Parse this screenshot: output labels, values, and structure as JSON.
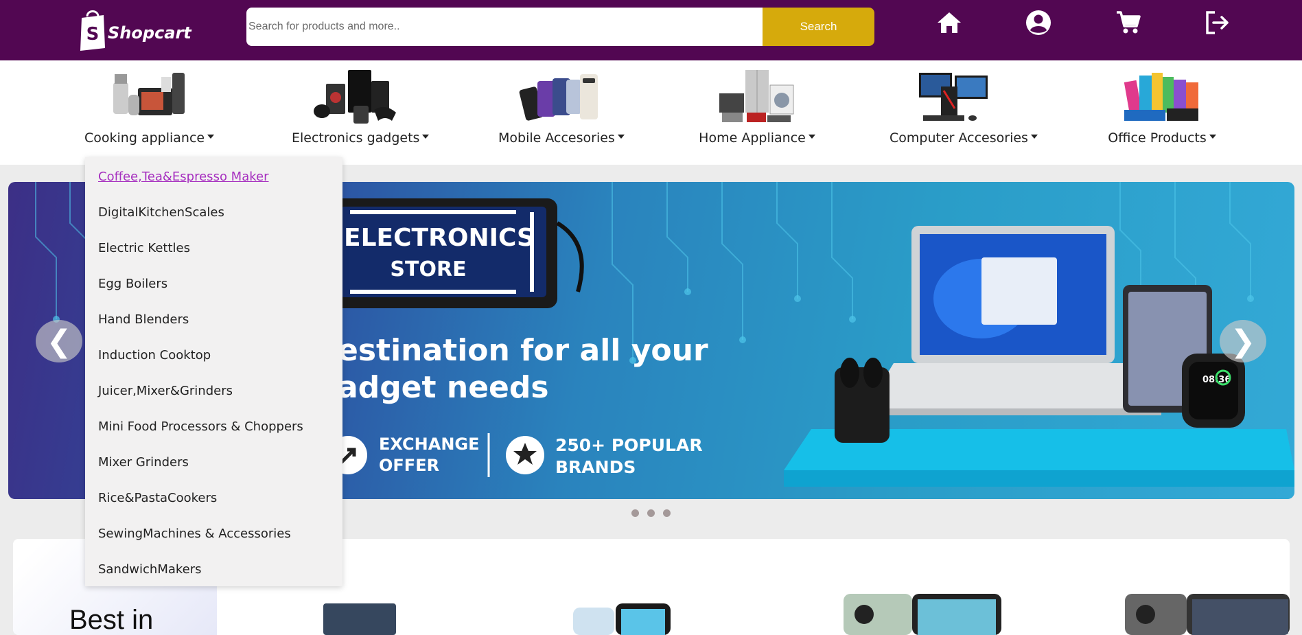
{
  "header": {
    "brand": "Shopcart",
    "logo_letter": "S",
    "search_placeholder": "Search for products and more..",
    "search_button": "Search",
    "icons": [
      "home-icon",
      "account-icon",
      "cart-icon",
      "logout-icon"
    ]
  },
  "categories": [
    {
      "label": "Cooking appliance"
    },
    {
      "label": "Electronics gadgets"
    },
    {
      "label": "Mobile Accesories"
    },
    {
      "label": "Home Appliance"
    },
    {
      "label": "Computer Accesories"
    },
    {
      "label": "Office Products"
    }
  ],
  "dropdown": {
    "items": [
      "Coffee,Tea&Espresso Maker",
      "DigitalKitchenScales",
      "Electric Kettles",
      "Egg Boilers",
      "Hand Blenders",
      "Induction Cooktop",
      "Juicer,Mixer&Grinders",
      "Mini Food Processors & Choppers",
      "Mixer Grinders",
      "Rice&PastaCookers",
      "SewingMachines & Accessories",
      "SandwichMakers"
    ]
  },
  "banner": {
    "sign_line1": "ELECTRONICS",
    "sign_line2": "STORE",
    "headline1": "estination for  all your",
    "headline2": "adget needs",
    "badge1_line1": "EXCHANGE",
    "badge1_line2": "OFFER",
    "badge2_line1": "250+ POPULAR",
    "badge2_line2": "BRANDS",
    "watch_time": "08:36",
    "prev_arrow": "❮",
    "next_arrow": "❯"
  },
  "best": {
    "title": "Best in"
  },
  "colors": {
    "header_bg": "#520752",
    "search_button": "#d6aa0c",
    "active_link": "#a62fbf"
  }
}
